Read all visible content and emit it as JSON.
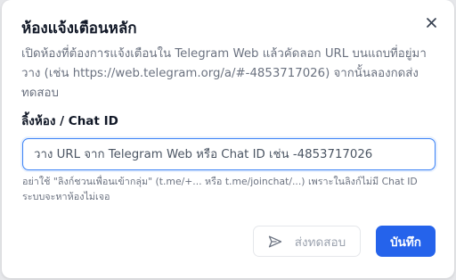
{
  "dialog": {
    "title": "ห้องแจ้งเตือนหลัก",
    "description": "เปิดห้องที่ต้องการแจ้งเตือนใน Telegram Web แล้วคัดลอก URL บนแถบที่อยู่มา วาง (เช่น https://web.telegram.org/a/#-4853717026) จากนั้นลองกดส่ง ทดสอบ",
    "field_label": "ลิ้งห้อง / Chat ID",
    "input_value": "",
    "input_placeholder": "วาง URL จาก Telegram Web หรือ Chat ID เช่น -4853717026",
    "hint": "อย่าใช้ \"ลิงก์ชวนเพื่อนเข้ากลุ่ม\" (t.me/+... หรือ t.me/joinchat/...) เพราะในลิงก์ไม่มี Chat ID ระบบจะหาห้องไม่เจอ",
    "test_button_label": "ส่งทดสอบ",
    "save_button_label": "บันทึก"
  },
  "icons": {
    "close": "close-icon",
    "send": "send-icon"
  },
  "colors": {
    "primary": "#2563eb",
    "focus_border": "#3b82f6",
    "title": "#111827",
    "muted_text": "#6b7280",
    "disabled_text": "#9ca3af"
  }
}
